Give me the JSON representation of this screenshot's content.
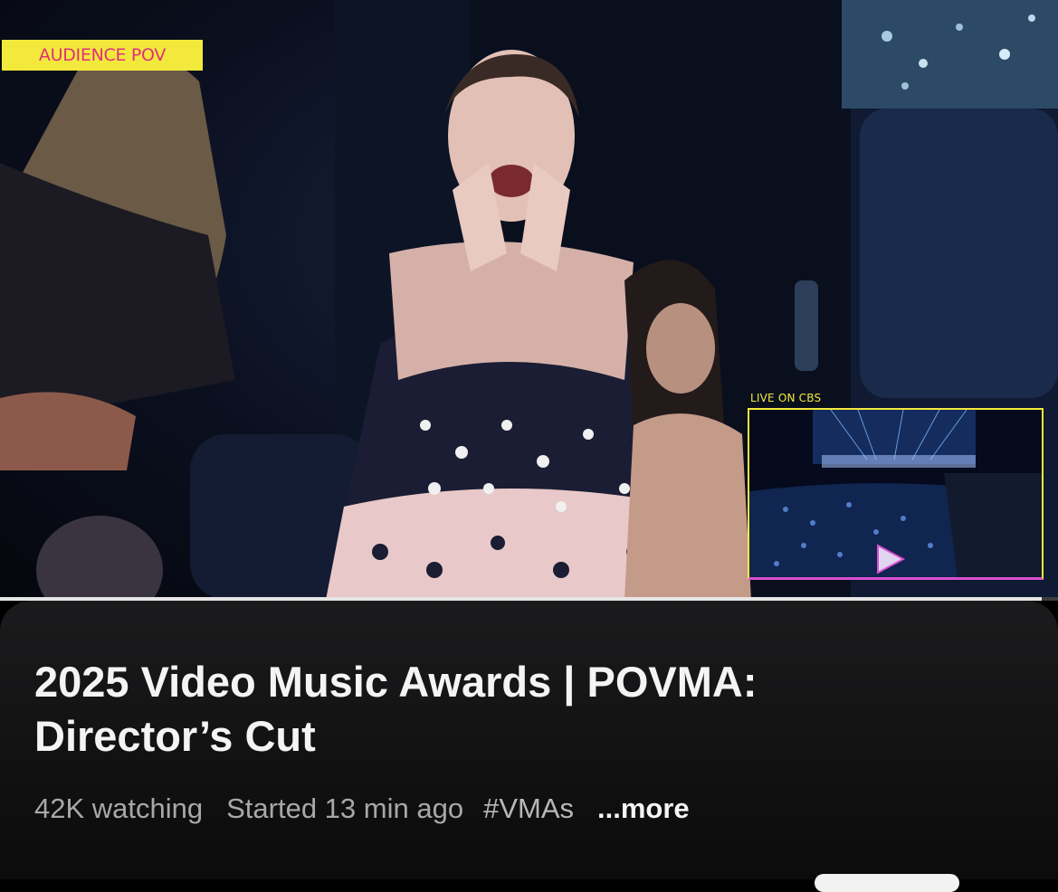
{
  "video": {
    "badge": "AUDIENCE POV",
    "pip_label": "LIVE ON CBS",
    "progress": 0.985
  },
  "details": {
    "title_line1": "2025 Video Music Awards | POVMA:",
    "title_line2": "Director’s Cut",
    "watching": "42K watching",
    "started": "Started 13 min ago",
    "hashtag": "#VMAs",
    "more": "...more"
  },
  "colors": {
    "badge_bg": "#f3e93c",
    "badge_text": "#e0307a",
    "pip_border_top": "#f3e93c",
    "pip_border_bottom": "#d94fd0"
  }
}
